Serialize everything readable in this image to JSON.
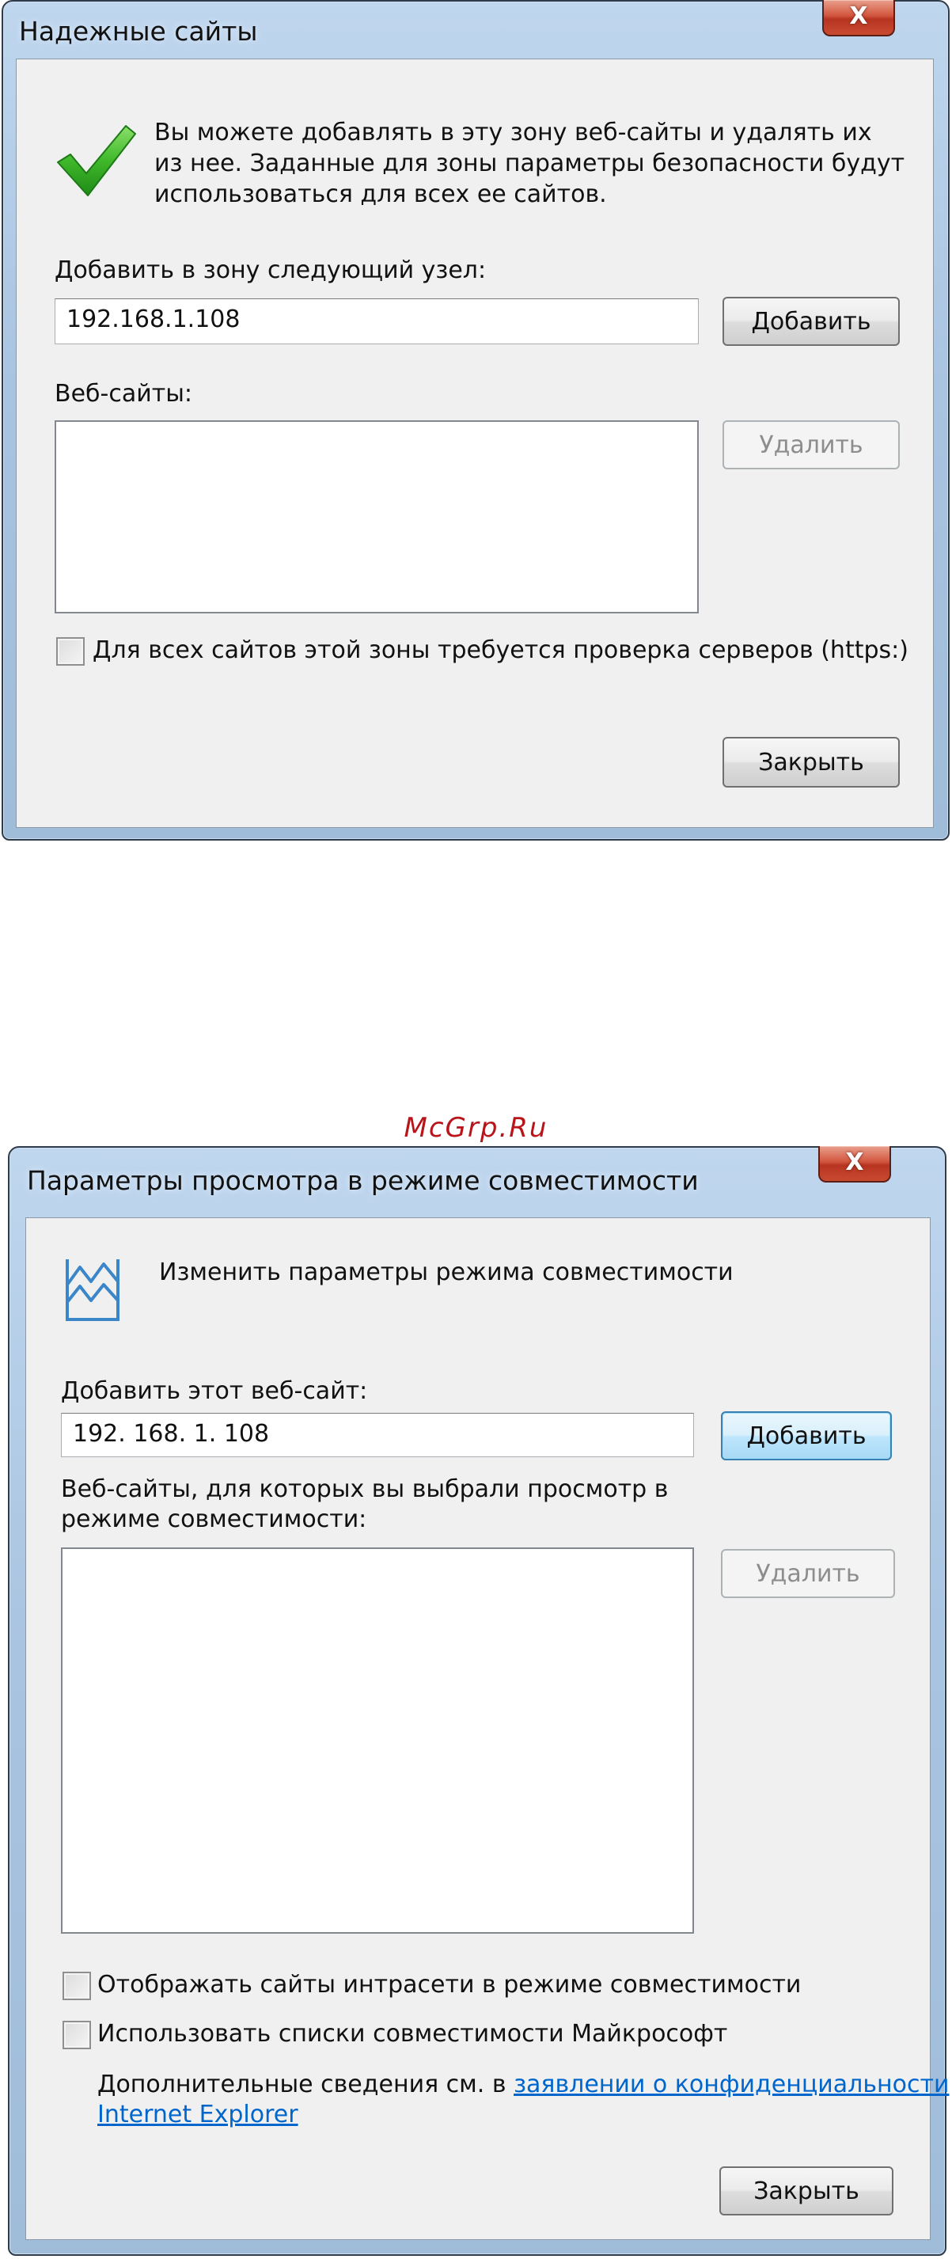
{
  "trusted_sites_dialog": {
    "title": "Надежные сайты",
    "close_glyph": "X",
    "info_icon": "green-checkmark-icon",
    "info_text_lines": [
      "Вы можете добавлять в эту зону  веб-сайты и удалять их",
      "из нее. Заданные для зоны параметры безопасности будут",
      "использоваться для всех ее сайтов."
    ],
    "add_label": "Добавить в зону следующий узел:",
    "add_input_value": "192.168.1.108",
    "add_button": "Добавить",
    "websites_label": "Веб-сайты:",
    "websites": [],
    "remove_button": "Удалить",
    "https_checkbox_label": "Для всех сайтов этой зоны требуется проверка серверов (https:)",
    "https_checked": false,
    "close_button": "Закрыть"
  },
  "watermark": "McGrp.Ru",
  "compat_dialog": {
    "title": "Параметры просмотра в режиме совместимости",
    "close_glyph": "X",
    "header_icon": "compatibility-view-icon",
    "header_text": "Изменить параметры режима совместимости",
    "add_label": "Добавить этот веб-сайт:",
    "add_input_value": "192. 168. 1. 108",
    "add_button": "Добавить",
    "websites_label_lines": [
      "Веб-сайты, для которых вы выбрали просмотр в",
      "режиме совместимости:"
    ],
    "websites": [],
    "remove_button": "Удалить",
    "intranet_checkbox_label": "Отображать сайты интрасети в режиме совместимости",
    "intranet_checked": false,
    "ms_lists_checkbox_label": "Использовать списки совместимости Майкрософт",
    "ms_lists_checked": false,
    "info_prefix": "Дополнительные сведения см. в ",
    "info_link_line1": "заявлении о конфиденциальности",
    "info_link_line2": "Internet Explorer",
    "close_button": "Закрыть"
  }
}
